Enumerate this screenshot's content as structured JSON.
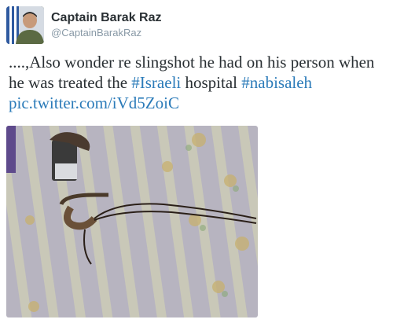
{
  "author": {
    "name": "Captain Barak Raz",
    "handle": "@CaptainBarakRaz",
    "avatar_icon": "avatar-soldier-photo"
  },
  "tweet": {
    "text_part1": "....,Also wonder re slingshot he had on his person when he was treated the ",
    "hashtag1": "#Israeli",
    "text_part2": " hospital ",
    "hashtag2": "#nabisaleh",
    "space": " ",
    "link": "pic.twitter.com/iVd5ZoiC"
  },
  "photo": {
    "description_icon": "slingshot-on-bed-photo",
    "colors": {
      "sheet": "#b9b6c0",
      "stripe": "#c9c6a8",
      "flower": "#c7b57a",
      "cord": "#3a2a1e"
    }
  },
  "colors": {
    "link": "#2b7bb9",
    "text": "#292f33",
    "muted": "#8899a6"
  }
}
